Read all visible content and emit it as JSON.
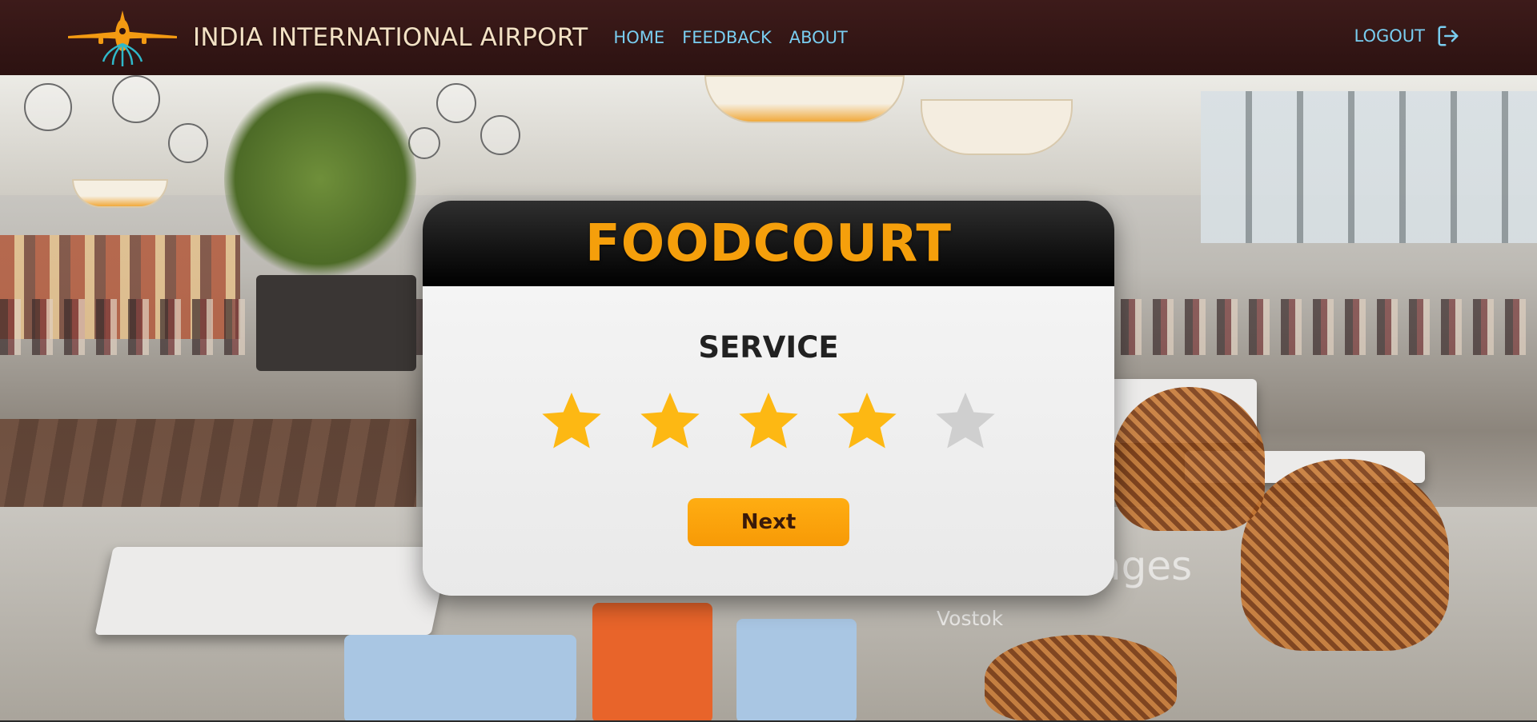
{
  "header": {
    "brand_title": "INDIA INTERNATIONAL AIRPORT",
    "logo_icon": "airplane-logo-icon",
    "nav": [
      {
        "label": "HOME"
      },
      {
        "label": "FEEDBACK"
      },
      {
        "label": "ABOUT"
      }
    ],
    "logout_label": "LOGOUT",
    "logout_icon": "logout-icon"
  },
  "background": {
    "watermark_text": "ages",
    "watermark_sub": "Vostok"
  },
  "card": {
    "title": "FOODCOURT",
    "criterion": "SERVICE",
    "rating": 4,
    "max_rating": 5,
    "next_label": "Next"
  },
  "colors": {
    "header_bg": "#3d1b1a",
    "brand_text": "#f3e1c4",
    "nav_link": "#79cdf0",
    "card_title": "#f59f0b",
    "star_filled": "#fdb813",
    "star_empty": "#cfcfcf",
    "button": "#ffad12"
  }
}
